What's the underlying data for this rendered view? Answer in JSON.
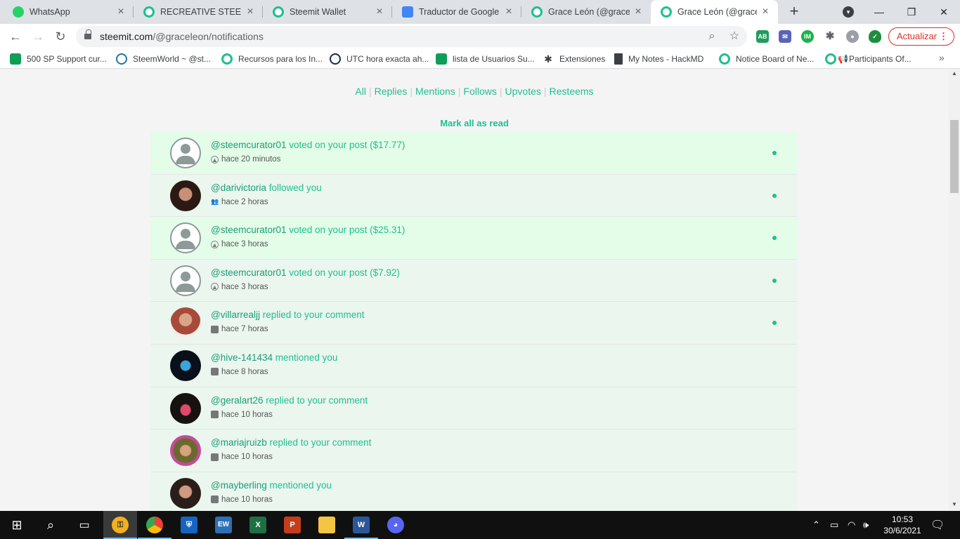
{
  "browser": {
    "tabs": [
      {
        "title": "WhatsApp",
        "favicon": "whatsapp-icon"
      },
      {
        "title": "RECREATIVE STEEM / t",
        "favicon": "steemit-icon"
      },
      {
        "title": "Steemit Wallet",
        "favicon": "steemit-icon"
      },
      {
        "title": "Traductor de Google",
        "favicon": "google-translate-icon"
      },
      {
        "title": "Grace León (@gracele",
        "favicon": "steemit-icon"
      },
      {
        "title": "Grace León (@gracele",
        "favicon": "steemit-icon",
        "active": true
      }
    ],
    "url_host": "steemit.com",
    "url_path": "/@graceleon/notifications",
    "update_label": "Actualizar",
    "bookmarks": [
      "500 SP Support cur...",
      "SteemWorld ~ @st...",
      "Recursos para los In...",
      "UTC hora exacta ah...",
      "lista de Usuarios Su...",
      "Extensiones",
      "My Notes - HackMD",
      "Notice Board of Ne...",
      "Participants Of..."
    ]
  },
  "notifications": {
    "filters": [
      "All",
      "Replies",
      "Mentions",
      "Follows",
      "Upvotes",
      "Resteems"
    ],
    "mark_all_read": "Mark all as read",
    "items": [
      {
        "user": "@steemcurator01",
        "action": "voted on your post ($17.77)",
        "time": "hace 20 minutos",
        "type": "upvote",
        "unread": true,
        "avatar": "default"
      },
      {
        "user": "@darivictoria",
        "action": "followed you",
        "time": "hace 2 horas",
        "type": "follow",
        "unread": false,
        "avatar": "photo"
      },
      {
        "user": "@steemcurator01",
        "action": "voted on your post ($25.31)",
        "time": "hace 3 horas",
        "type": "upvote",
        "unread": true,
        "avatar": "default"
      },
      {
        "user": "@steemcurator01",
        "action": "voted on your post ($7.92)",
        "time": "hace 3 horas",
        "type": "upvote",
        "unread": false,
        "avatar": "default"
      },
      {
        "user": "@villarrealjj",
        "action": "replied to your comment",
        "time": "hace 7 horas",
        "type": "comment",
        "unread": false,
        "avatar": "photo"
      },
      {
        "user": "@hive-141434",
        "action": "mentioned you",
        "time": "hace 8 horas",
        "type": "comment",
        "unread": false,
        "avatar": "logo"
      },
      {
        "user": "@geralart26",
        "action": "replied to your comment",
        "time": "hace 10 horas",
        "type": "comment",
        "unread": false,
        "avatar": "photo"
      },
      {
        "user": "@mariajruizb",
        "action": "replied to your comment",
        "time": "hace 10 horas",
        "type": "comment",
        "unread": false,
        "avatar": "photo"
      },
      {
        "user": "@mayberling",
        "action": "mentioned you",
        "time": "hace 10 horas",
        "type": "comment",
        "unread": false,
        "avatar": "photo"
      }
    ]
  },
  "taskbar": {
    "time": "10:53",
    "date": "30/6/2021"
  },
  "colors": {
    "accent": "#1fbf8f",
    "unread_bg": "#e3fde8",
    "read_bg": "#eaf6ee"
  }
}
